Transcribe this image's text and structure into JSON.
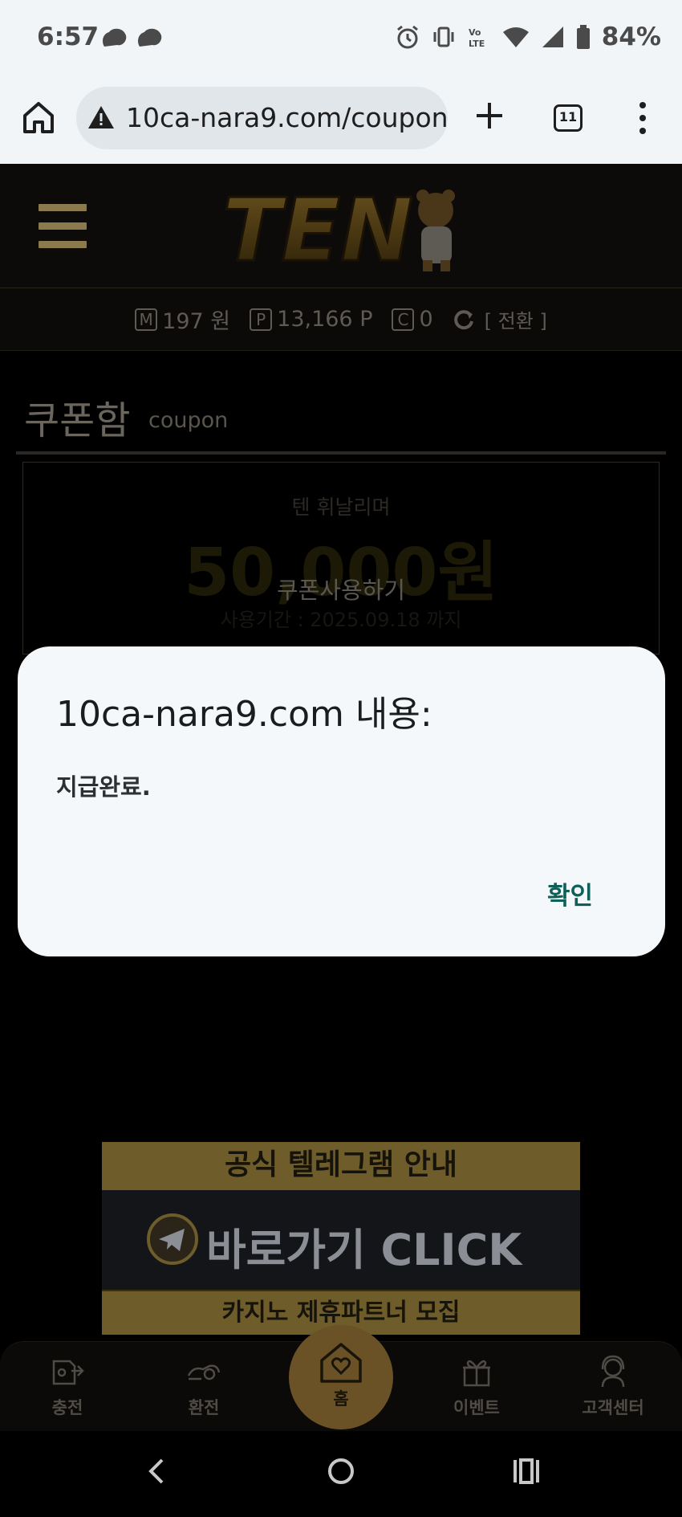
{
  "status_bar": {
    "time": "6:57",
    "battery": "84%"
  },
  "browser": {
    "url": "10ca-nara9.com/coupon",
    "tab_count": "11"
  },
  "points": {
    "money_badge": "M",
    "money_value": "197 원",
    "point_badge": "P",
    "point_value": "13,166 P",
    "coin_badge": "C",
    "coin_value": "0",
    "convert_label": "[ 전환 ]"
  },
  "page": {
    "title": "쿠폰함",
    "subtitle": "coupon",
    "coupon": {
      "name": "텐 휘날리며",
      "amount": "50,000원",
      "use_label": "쿠폰사용하기",
      "expire": "사용기간 : 2025.09.18 까지"
    }
  },
  "dialog": {
    "title": "10ca-nara9.com 내용:",
    "message": "지급완료.",
    "ok_label": "확인"
  },
  "banner": {
    "top_text": "공식 텔레그램 안내",
    "middle_text": "바로가기 CLICK",
    "bottom_text": "카지노 제휴파트너 모집"
  },
  "bottom_nav": {
    "items": [
      {
        "label": "충전",
        "icon": "charge-icon"
      },
      {
        "label": "환전",
        "icon": "exchange-icon"
      },
      {
        "label": "홈",
        "icon": "home-heart-icon"
      },
      {
        "label": "이벤트",
        "icon": "gift-icon"
      },
      {
        "label": "고객센터",
        "icon": "support-icon"
      }
    ]
  },
  "colors": {
    "gold": "#8b7a4b",
    "dialog_bg": "#f4f8fa",
    "dialog_button": "#0f6058",
    "home_circle": "#6a5226"
  }
}
